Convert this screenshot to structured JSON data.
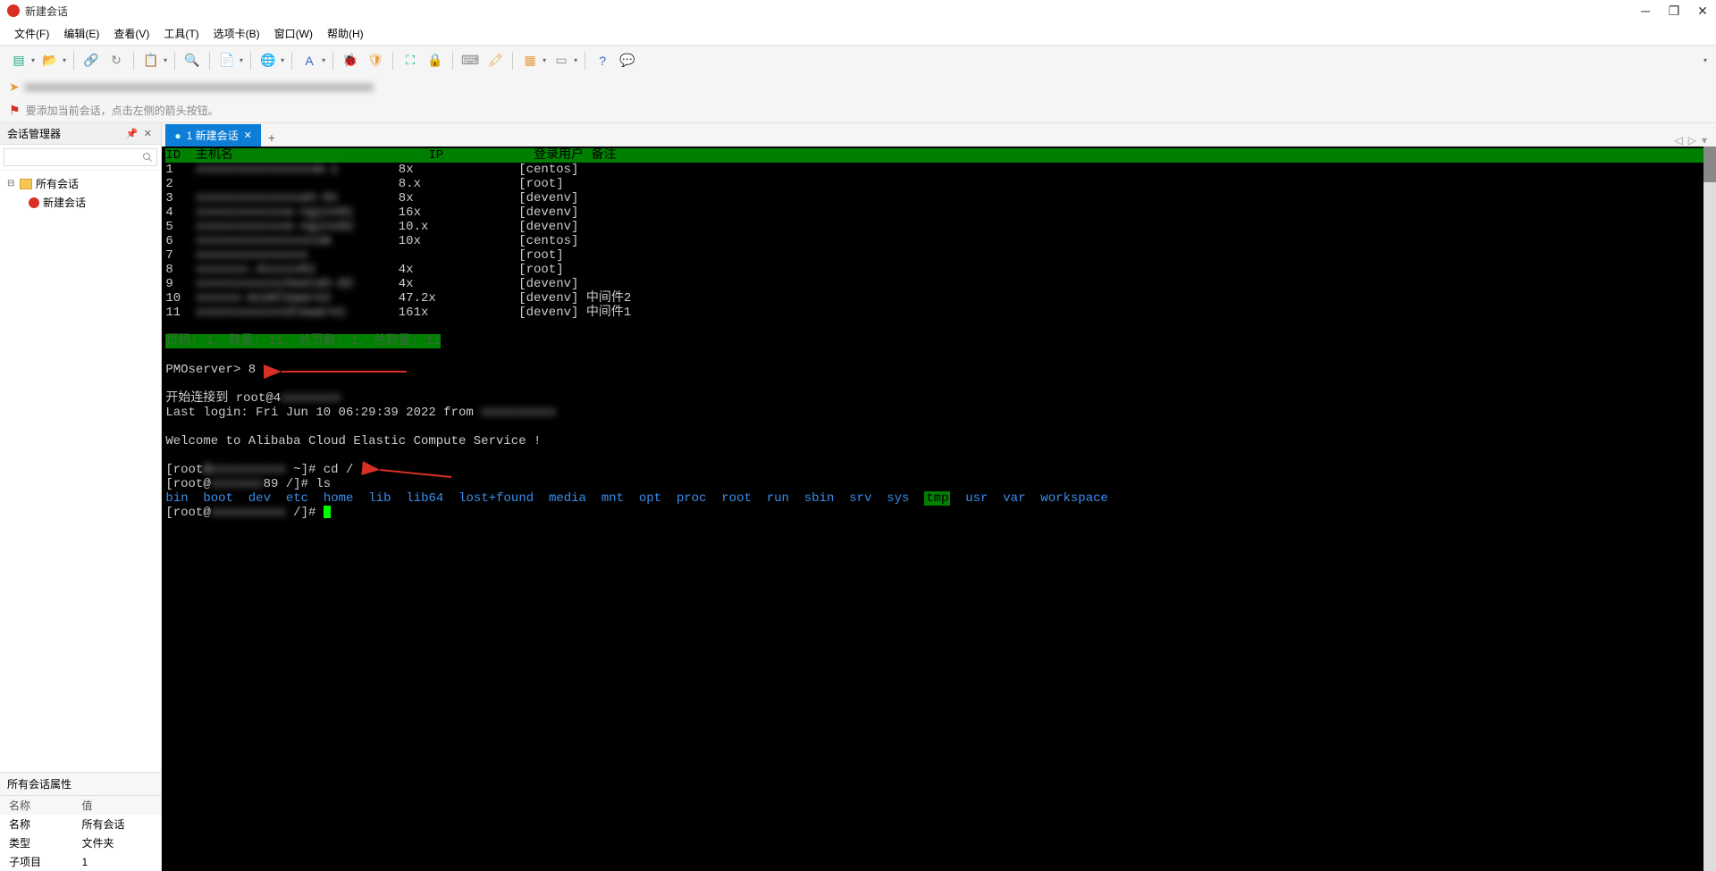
{
  "title": "新建会话",
  "menu": [
    "文件(F)",
    "编辑(E)",
    "查看(V)",
    "工具(T)",
    "选项卡(B)",
    "窗口(W)",
    "帮助(H)"
  ],
  "hint": "要添加当前会话，点击左侧的箭头按钮。",
  "sidebar": {
    "title": "会话管理器",
    "search_placeholder": "",
    "tree": {
      "root": "所有会话",
      "child": "新建会话"
    }
  },
  "props": {
    "title": "所有会话属性",
    "headers": [
      "名称",
      "值"
    ],
    "rows": [
      [
        "名称",
        "所有会话"
      ],
      [
        "类型",
        "文件夹"
      ],
      [
        "子项目",
        "1"
      ]
    ]
  },
  "tab": {
    "label": "1 新建会话"
  },
  "terminal": {
    "header_cols": "ID  主机名                          IP            登录用户 备注",
    "rows": [
      {
        "id": "1",
        "host": "xxxxxxxxxxxxxxxxm-1",
        "ip": "8x",
        "user": "[centos]",
        "remark": ""
      },
      {
        "id": "2",
        "host": "",
        "ip": "8.x",
        "user": "[root]",
        "remark": ""
      },
      {
        "id": "3",
        "host": "xxxxxxxxxxxxxxah-01",
        "ip": "8x",
        "user": "[devenv]",
        "remark": ""
      },
      {
        "id": "4",
        "host": "xxxxxxxxxxxxe-nginx01",
        "ip": "16x",
        "user": "[devenv]",
        "remark": ""
      },
      {
        "id": "5",
        "host": "xxxxxxxxxxxxe-nginx02",
        "ip": "10.x",
        "user": "[devenv]",
        "remark": ""
      },
      {
        "id": "6",
        "host": "xxxxxxxxxxxxxxxcom",
        "ip": "10x",
        "user": "[centos]",
        "remark": ""
      },
      {
        "id": "7",
        "host": "xxxxxxxxxxxxxxx",
        "ip": "",
        "user": "[root]",
        "remark": ""
      },
      {
        "id": "8",
        "host": "xxxxxxx.4xxxxx01",
        "ip": "4x",
        "user": "[root]",
        "remark": ""
      },
      {
        "id": "9",
        "host": "xxxxxxxxxxxcheetah-02",
        "ip": "4x",
        "user": "[devenv]",
        "remark": ""
      },
      {
        "id": "10",
        "host": "xxxxxx-middleware2",
        "ip": "47.2x",
        "user": "[devenv]",
        "remark": "中间件2"
      },
      {
        "id": "11",
        "host": "xxxxxxxxxxxxdleware1",
        "ip": "161x",
        "user": "[devenv]",
        "remark": "中间件1"
      }
    ],
    "summary": "页码: 1, 数量: 11, 总页数: 1, 总数量: 11",
    "prompt_line": "PMOserver> 8",
    "connect_line": "开始连接到 root@4",
    "last_login": "Last login: Fri Jun 10 06:29:39 2022 from ",
    "welcome": "Welcome to Alibaba Cloud Elastic Compute Service !",
    "cmd1": "[root@xxxxxxxxxxx ~]# cd /",
    "cmd2": "[root@xxxxxxxxx89 /]# ls",
    "ls_dirs": [
      "bin",
      "boot",
      "dev",
      "etc",
      "home",
      "lib",
      "lib64",
      "lost+found",
      "media",
      "mnt",
      "opt",
      "proc",
      "root",
      "run",
      "sbin",
      "srv",
      "sys"
    ],
    "ls_tmp": "tmp",
    "ls_tail": [
      "usr",
      "var",
      "workspace"
    ],
    "cmd3": "[root@xxxxxxxxxxx /]# "
  }
}
